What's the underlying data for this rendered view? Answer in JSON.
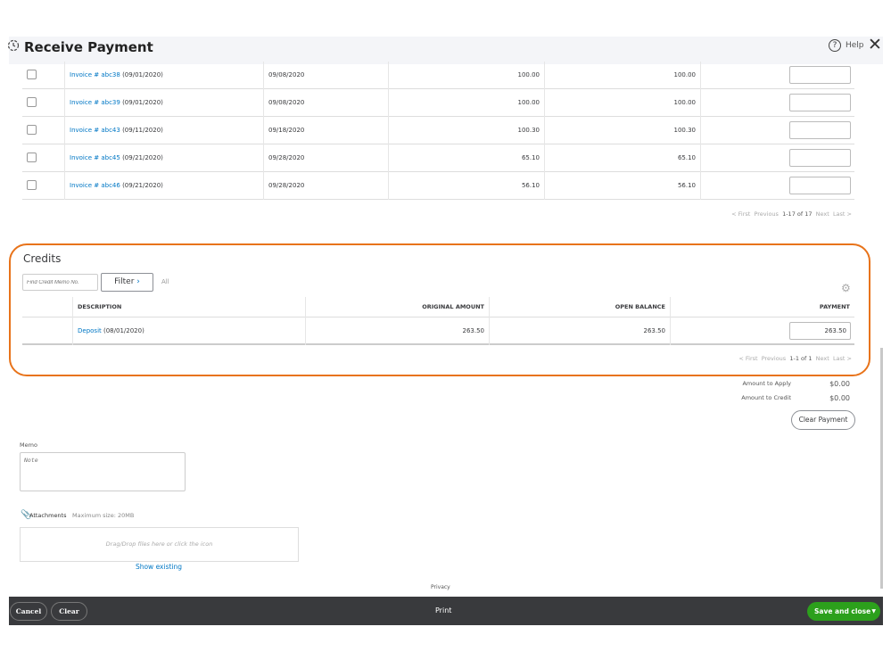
{
  "header": {
    "title": "Receive Payment",
    "help": "Help"
  },
  "invoices": {
    "rows": [
      {
        "ref": "Invoice # abc38",
        "date": "(09/01/2020)",
        "due": "09/08/2020",
        "original": "100.00",
        "open": "100.00",
        "payment": ""
      },
      {
        "ref": "Invoice # abc39",
        "date": "(09/01/2020)",
        "due": "09/08/2020",
        "original": "100.00",
        "open": "100.00",
        "payment": ""
      },
      {
        "ref": "Invoice # abc43",
        "date": "(09/11/2020)",
        "due": "09/18/2020",
        "original": "100.30",
        "open": "100.30",
        "payment": ""
      },
      {
        "ref": "Invoice # abc45",
        "date": "(09/21/2020)",
        "due": "09/28/2020",
        "original": "65.10",
        "open": "65.10",
        "payment": ""
      },
      {
        "ref": "Invoice # abc46",
        "date": "(09/21/2020)",
        "due": "09/28/2020",
        "original": "56.10",
        "open": "56.10",
        "payment": ""
      }
    ],
    "pager": {
      "first": "< First",
      "previous": "Previous",
      "range": "1-17 of 17",
      "next": "Next",
      "last": "Last >"
    }
  },
  "credits": {
    "title": "Credits",
    "search_placeholder": "Find Credit Memo No.",
    "filter": "Filter",
    "filter_value": "All",
    "columns": [
      "DESCRIPTION",
      "ORIGINAL AMOUNT",
      "OPEN BALANCE",
      "PAYMENT"
    ],
    "rows": [
      {
        "ref": "Deposit",
        "date": "(08/01/2020)",
        "original": "263.50",
        "open": "263.50",
        "payment": "263.50"
      }
    ],
    "pager": {
      "first": "< First",
      "previous": "Previous",
      "range": "1-1 of 1",
      "next": "Next",
      "last": "Last >"
    },
    "highlight_color": "#e8731a"
  },
  "totals": {
    "apply_label": "Amount to Apply",
    "apply_value": "$0.00",
    "credit_label": "Amount to Credit",
    "credit_value": "$0.00",
    "clear_payment": "Clear Payment"
  },
  "memo": {
    "label": "Memo",
    "placeholder": "Note"
  },
  "attachments": {
    "label": "Attachments",
    "max_size": "Maximum size: 20MB",
    "dropzone": "Drag/Drop files here or click the icon",
    "show_existing": "Show existing"
  },
  "privacy": "Privacy",
  "footer": {
    "cancel": "Cancel",
    "clear": "Clear",
    "print": "Print",
    "save": "Save and close",
    "save_color": "#2ca01c"
  }
}
